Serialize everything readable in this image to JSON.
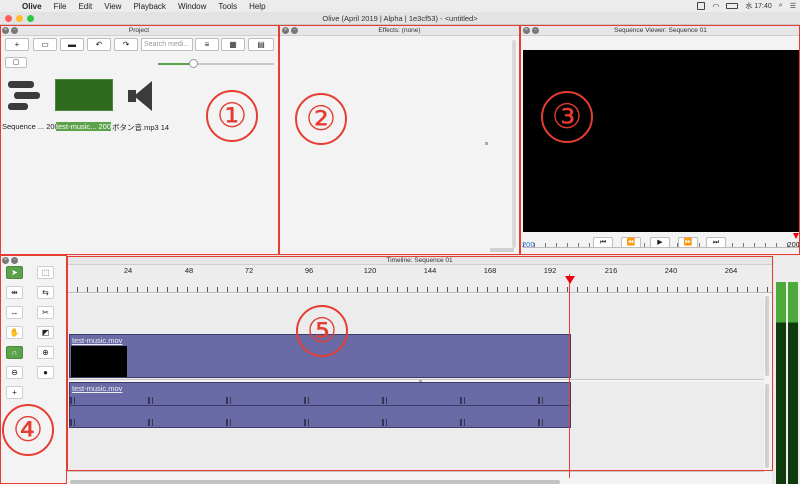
{
  "menubar": {
    "items": [
      "Olive",
      "File",
      "Edit",
      "View",
      "Playback",
      "Window",
      "Tools",
      "Help"
    ],
    "clock": "水 17:40"
  },
  "window": {
    "title": "Olive (April 2019 | Alpha | 1e3cf53) - <untitled>"
  },
  "project": {
    "title": "Project",
    "search_placeholder": "Search medi...",
    "zoom": 0.3,
    "items": [
      {
        "label": "Sequence ... 200",
        "icon": "sequence-icon"
      },
      {
        "label": "test-music... 200",
        "icon": "video-thumbnail"
      },
      {
        "label": "ボタン音.mp3 14",
        "icon": "speaker-icon"
      }
    ]
  },
  "effects": {
    "title": "Effects: (none)"
  },
  "viewer": {
    "title": "Sequence Viewer: Sequence 01",
    "start_tc": "200",
    "end_tc": "200"
  },
  "timeline": {
    "title": "Timeline: Sequence 01",
    "ticks": [
      "24",
      "48",
      "72",
      "96",
      "120",
      "144",
      "168",
      "192",
      "216",
      "240",
      "264"
    ],
    "video_clip": "test-music.mov",
    "audio_clip": "test-music.mov"
  },
  "annotations": [
    "①",
    "②",
    "③",
    "④",
    "⑤"
  ],
  "colors": {
    "accent_green": "#5ca24a",
    "annotation_red": "#e53d32",
    "clip_purple": "#6a6aa6"
  }
}
